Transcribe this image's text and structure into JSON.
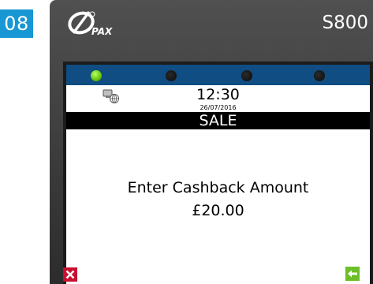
{
  "step": {
    "number": "08",
    "badge_color": "#1797d3"
  },
  "terminal": {
    "brand_logo": "PAX",
    "model": "S800",
    "led_colors": {
      "active": "#64c40c",
      "inactive": "#0a0a0a"
    },
    "status_bar_color": "#104d82"
  },
  "screen": {
    "status_icon": "network-icon",
    "time": "12:30",
    "date": "26/07/2016",
    "title": "SALE",
    "prompt": "Enter Cashback Amount",
    "amount": "£20.00"
  },
  "softkeys": {
    "cancel": {
      "icon": "close-icon",
      "color": "#c8102e"
    },
    "enter": {
      "icon": "arrow-left-icon",
      "color": "#6cbf26"
    }
  }
}
